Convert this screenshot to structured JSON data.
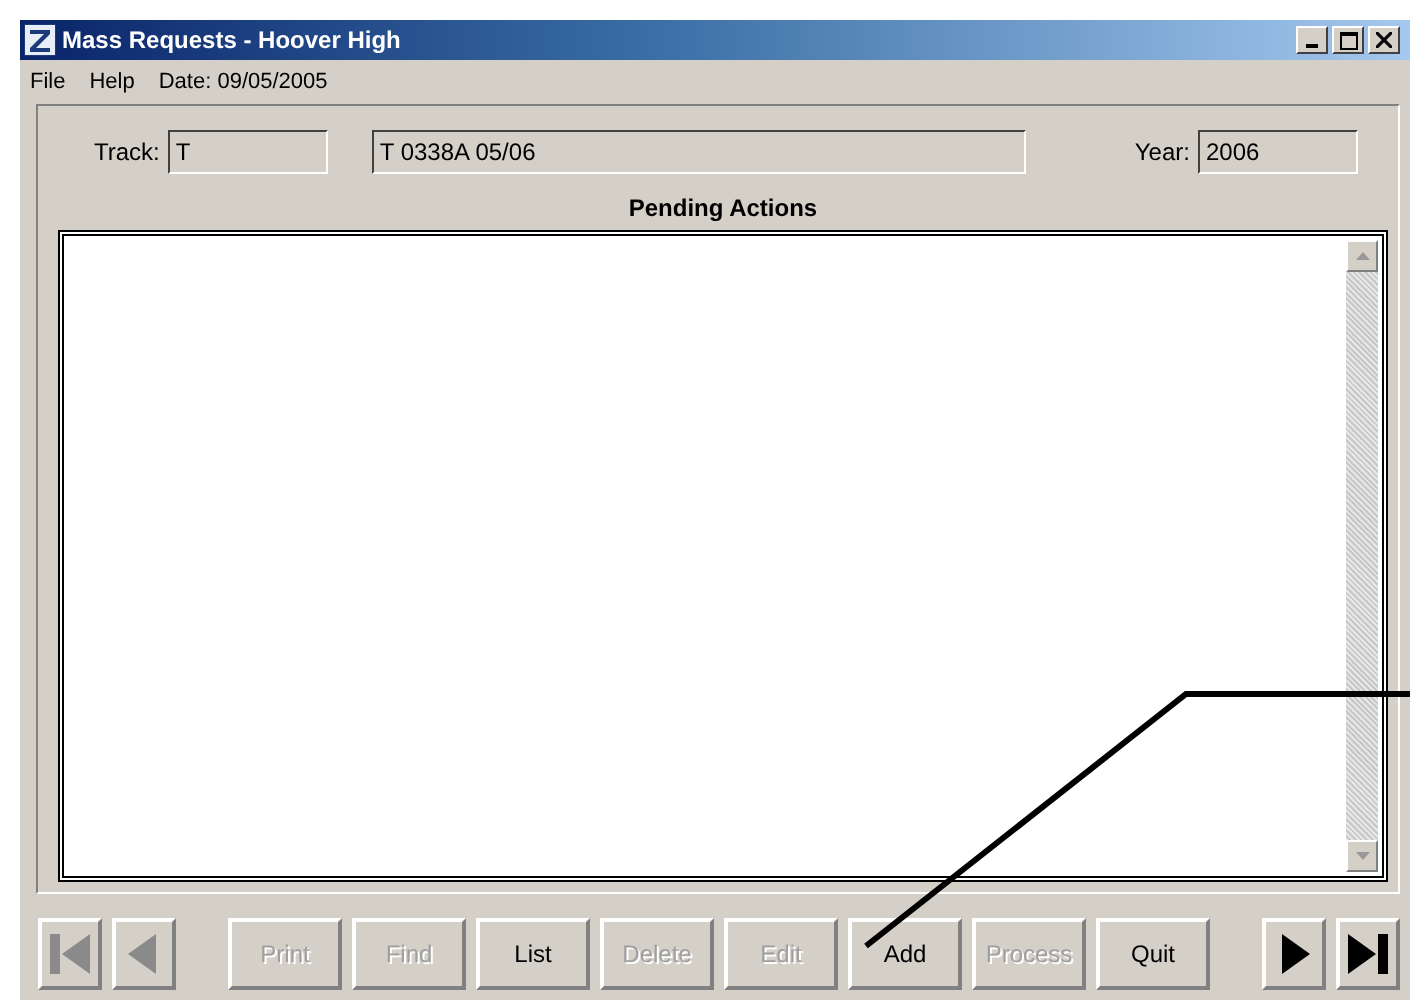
{
  "window": {
    "title": "Mass Requests - Hoover High"
  },
  "menu": [
    {
      "label": "File"
    },
    {
      "label": "Help"
    }
  ],
  "date": "Date: 09/05/2005",
  "track": {
    "label": "Track:",
    "value": "T"
  },
  "description": {
    "value": "T 0338A 05/06"
  },
  "year": {
    "label": "Year:",
    "value": "2006"
  },
  "pending": {
    "title": "Pending Actions"
  },
  "nav_left": [
    {
      "kind": "first",
      "disabled": true
    },
    {
      "kind": "prev",
      "disabled": true
    }
  ],
  "buttons": [
    {
      "label": "Print",
      "disabled": true
    },
    {
      "label": "Find",
      "disabled": true
    },
    {
      "label": "List",
      "disabled": false
    },
    {
      "label": "Delete",
      "disabled": true
    },
    {
      "label": "Edit",
      "disabled": true
    },
    {
      "label": "Add",
      "disabled": false
    },
    {
      "label": "Process",
      "disabled": true
    },
    {
      "label": "Quit",
      "disabled": false
    }
  ],
  "nav_right": [
    {
      "kind": "next",
      "disabled": false
    },
    {
      "kind": "last",
      "disabled": false
    }
  ]
}
